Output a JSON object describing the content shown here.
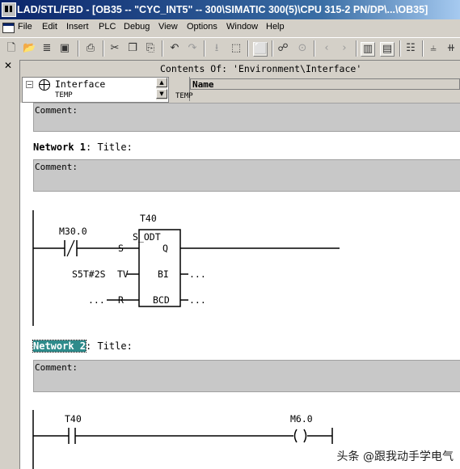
{
  "window": {
    "title": "LAD/STL/FBD  - [OB35 -- \"CYC_INT5\" -- 300\\SIMATIC 300(5)\\CPU 315-2 PN/DP\\...\\OB35]"
  },
  "menu": [
    "File",
    "Edit",
    "Insert",
    "PLC",
    "Debug",
    "View",
    "Options",
    "Window",
    "Help"
  ],
  "toolbar": {
    "icons": [
      "new-icon",
      "open-icon",
      "accessible-nodes-icon",
      "save-icon",
      "print-icon",
      "cut-icon",
      "copy-icon",
      "paste-icon",
      "undo-icon",
      "redo-icon",
      "load-icon",
      "monitor-icon",
      "overview-icon",
      "network-icon",
      "go-online-icon",
      "go-offline-icon",
      "prev-network-icon",
      "next-network-icon",
      "details-icon",
      "view-icon",
      "address-icon",
      "contact-no-icon",
      "contact-nc-icon"
    ]
  },
  "interface": {
    "contents_label": "Contents Of: 'Environment\\Interface'",
    "tree_root": "Interface",
    "tree_child": "TEMP",
    "column_name": "Name",
    "row_temp": "TEMP"
  },
  "editor": {
    "top_comment": "Comment:",
    "network1": {
      "label": "Network 1",
      "title": ": Title:",
      "comment": "Comment:",
      "contact": "M30.0",
      "timer": "T40",
      "block": "S_ODT",
      "pin_s": "S",
      "pin_q": "Q",
      "pin_tv": "TV",
      "pin_bi": "BI",
      "pin_r": "R",
      "pin_bcd": "BCD",
      "tv_value": "S5T#2S",
      "r_value": "...",
      "bi_value": "...",
      "bcd_value": "..."
    },
    "network2": {
      "label": "Network 2",
      "title": ": Title:",
      "comment": "Comment:",
      "contact": "T40",
      "coil": "M6.0"
    }
  },
  "watermark": "头条 @跟我动手学电气"
}
